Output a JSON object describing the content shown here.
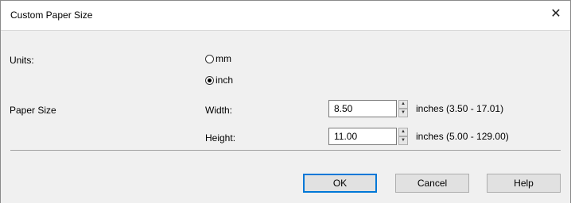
{
  "window": {
    "title": "Custom Paper Size",
    "close_glyph": "✕"
  },
  "units": {
    "label": "Units:",
    "options": [
      {
        "label": "mm",
        "selected": false
      },
      {
        "label": "inch",
        "selected": true
      }
    ]
  },
  "paper_size": {
    "label": "Paper Size",
    "width": {
      "label": "Width:",
      "value": "8.50",
      "range": "inches (3.50 - 17.01)"
    },
    "height": {
      "label": "Height:",
      "value": "11.00",
      "range": "inches (5.00 - 129.00)"
    }
  },
  "buttons": {
    "ok": "OK",
    "cancel": "Cancel",
    "help": "Help"
  },
  "icons": {
    "close": "close-icon",
    "spin_up": "spin-up-icon",
    "spin_down": "spin-down-icon"
  }
}
